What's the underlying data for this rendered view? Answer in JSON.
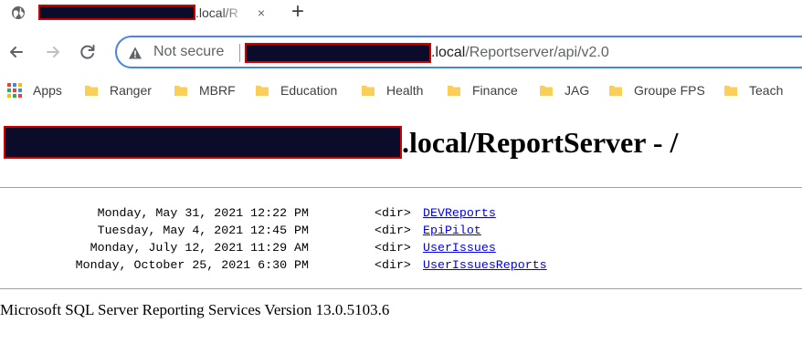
{
  "tab": {
    "title_suffix": ".local/R",
    "close_glyph": "×",
    "new_tab_glyph": "+"
  },
  "toolbar": {
    "not_secure_label": "Not secure",
    "url_host_suffix": ".local",
    "url_path": "/Reportserver/api/v2.0"
  },
  "bookmarks": [
    {
      "label": "Apps",
      "icon": "apps-grid-icon"
    },
    {
      "label": "Ranger",
      "icon": "folder-icon"
    },
    {
      "label": "MBRF",
      "icon": "folder-icon"
    },
    {
      "label": "Education",
      "icon": "folder-icon"
    },
    {
      "label": "Health",
      "icon": "folder-icon"
    },
    {
      "label": "Finance",
      "icon": "folder-icon"
    },
    {
      "label": "JAG",
      "icon": "folder-icon"
    },
    {
      "label": "Groupe FPS",
      "icon": "folder-icon"
    },
    {
      "label": "Teach",
      "icon": "folder-icon"
    }
  ],
  "page": {
    "heading_suffix": ".local/ReportServer - /",
    "entries": [
      {
        "date": "Monday, May 31, 2021 12:22 PM",
        "type": "<dir>",
        "name": "DEVReports"
      },
      {
        "date": "Tuesday, May 4, 2021 12:45 PM",
        "type": "<dir>",
        "name": "EpiPilot"
      },
      {
        "date": "Monday, July 12, 2021 11:29 AM",
        "type": "<dir>",
        "name": "UserIssues"
      },
      {
        "date": "Monday, October 25, 2021 6:30 PM",
        "type": "<dir>",
        "name": "UserIssuesReports"
      }
    ],
    "footer": "Microsoft SQL Server Reporting Services Version 13.0.5103.6"
  },
  "colors": {
    "link": "#0000ee",
    "omnibox_border": "#4a84e4",
    "folder": "#f9cf5a",
    "redaction_fill": "#0b0b2a",
    "redaction_border": "#d00000"
  }
}
